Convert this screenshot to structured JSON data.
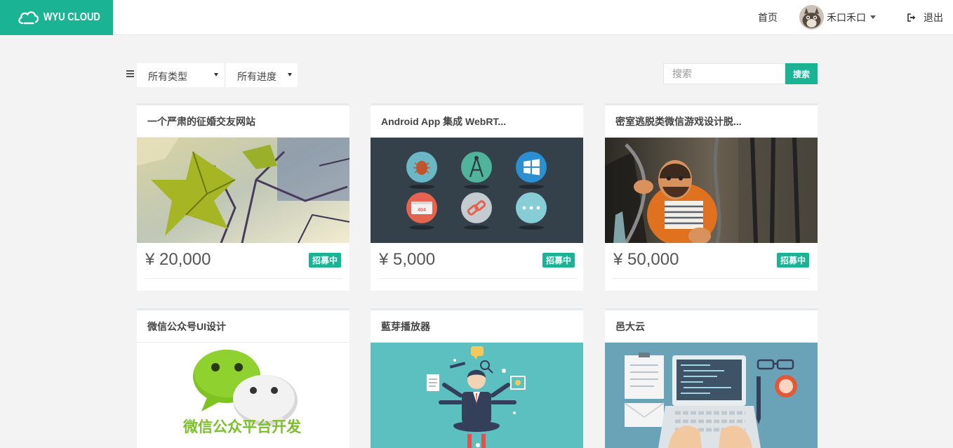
{
  "header": {
    "logo_text": "WYU CLOUD",
    "nav_home": "首页",
    "user_name": "禾口禾口",
    "logout": "退出"
  },
  "filters": {
    "type_select": "所有类型",
    "progress_select": "所有进度",
    "search_placeholder": "搜索",
    "search_button": "搜索"
  },
  "projects": [
    {
      "title": "一个严肃的征婚交友网站",
      "price": "¥ 20,000",
      "status": "招募中"
    },
    {
      "title": "Android App 集成 WebRT...",
      "price": "¥ 5,000",
      "status": "招募中"
    },
    {
      "title": "密室逃脱类微信游戏设计脱...",
      "price": "¥ 50,000",
      "status": "招募中"
    },
    {
      "title": "微信公众号UI设计",
      "image_text": "微信公众平台开发"
    },
    {
      "title": "藍芽播放器"
    },
    {
      "title": "邑大云"
    }
  ],
  "colors": {
    "accent": "#1ab394",
    "background": "#f3f3f3"
  }
}
